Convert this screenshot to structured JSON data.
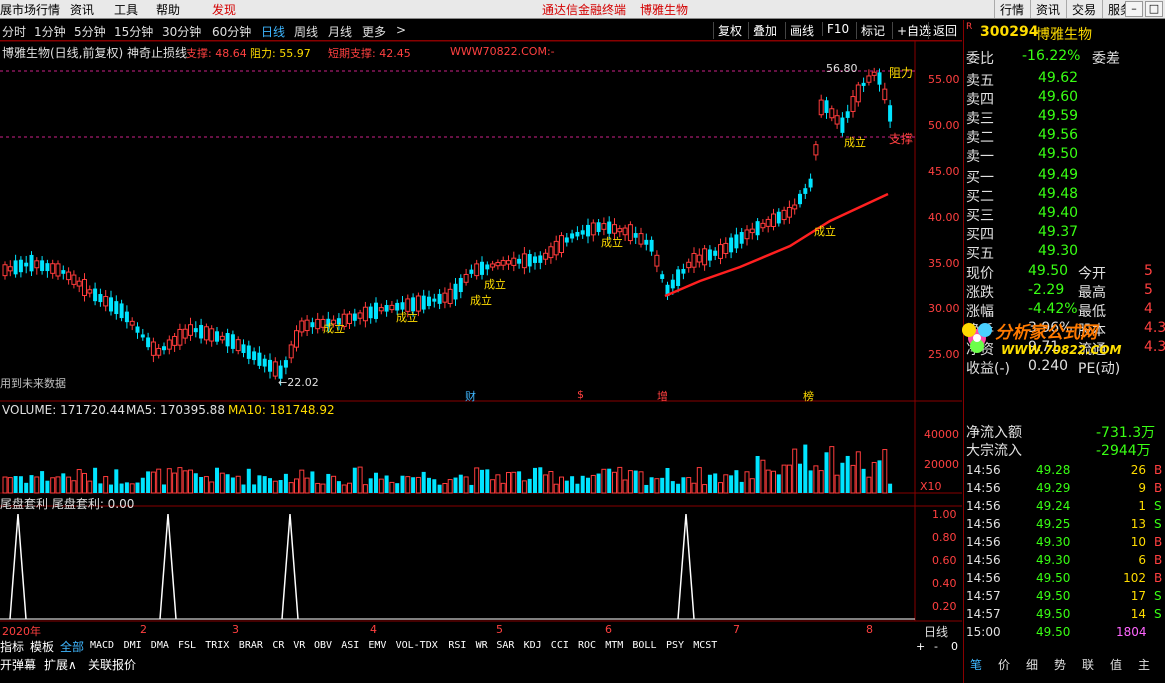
{
  "menubar": {
    "left_items": [
      "展市场行情",
      "资讯",
      "工具",
      "帮助"
    ],
    "discover": "发现",
    "center_links": [
      "通达信金融终端",
      "博雅生物"
    ],
    "right_buttons": [
      "行情",
      "资讯",
      "交易",
      "服务"
    ]
  },
  "periods": [
    "分时",
    "1分钟",
    "5分钟",
    "15分钟",
    "30分钟",
    "60分钟",
    "日线",
    "周线",
    "月线",
    "更多"
  ],
  "active_period": "日线",
  "more_arrow": ">",
  "chart_toolbar": [
    "复权",
    "叠加",
    "画线",
    "F10",
    "标记",
    "+自选",
    "返回"
  ],
  "chart_header": {
    "title": "博雅生物(日线,前复权) 神奇止损线",
    "support": "支撑: 48.64",
    "resistance": "阻力: 55.97",
    "short_support": "短期支撑: 42.45",
    "watermark_url": "WWW70822.COM:-"
  },
  "annotations": {
    "high": "56.80",
    "low": "←22.02",
    "resist_tag": "阻力",
    "support_tag": "支撑",
    "chengli": "成立",
    "future": "用到未来数据",
    "events": [
      "财",
      "$",
      "增",
      "榜"
    ]
  },
  "price_axis": [
    "55.00",
    "50.00",
    "45.00",
    "40.00",
    "35.00",
    "30.00",
    "25.00"
  ],
  "volume_header": {
    "label": "VOLUME: 171720.44",
    "ma5": "MA5: 170395.88",
    "ma10": "MA10: 181748.92"
  },
  "volume_axis": [
    "40000",
    "20000",
    "X10"
  ],
  "indicator_header": "尾盘套利  尾盘套利: 0.00",
  "indicator_axis": [
    "1.00",
    "0.80",
    "0.60",
    "0.40",
    "0.20"
  ],
  "date_axis": [
    "2020年",
    "2",
    "3",
    "4",
    "5",
    "6",
    "7",
    "8"
  ],
  "date_corner": "日线",
  "bottom_nav": [
    "指标",
    "模板",
    "全部"
  ],
  "indicator_tabs": [
    "MACD",
    "DMI",
    "DMA",
    "FSL",
    "TRIX",
    "BRAR",
    "CR",
    "VR",
    "OBV",
    "ASI",
    "EMV",
    "VOL-TDX",
    "RSI",
    "WR",
    "SAR",
    "KDJ",
    "CCI",
    "ROC",
    "MTM",
    "BOLL",
    "PSY",
    "MCST"
  ],
  "bottom_row": [
    "开弹幕",
    "扩展∧",
    "关联报价"
  ],
  "corner_controls": [
    "+",
    "-",
    "0"
  ],
  "quote": {
    "code": "300294",
    "name": "博雅生物",
    "weibi_label": "委比",
    "weibi": "-16.22%",
    "weicha_label": "委差",
    "sells": [
      {
        "label": "卖五",
        "price": "49.62"
      },
      {
        "label": "卖四",
        "price": "49.60"
      },
      {
        "label": "卖三",
        "price": "49.59"
      },
      {
        "label": "卖二",
        "price": "49.56"
      },
      {
        "label": "卖一",
        "price": "49.50"
      }
    ],
    "buys": [
      {
        "label": "买一",
        "price": "49.49"
      },
      {
        "label": "买二",
        "price": "49.48"
      },
      {
        "label": "买三",
        "price": "49.40"
      },
      {
        "label": "买四",
        "price": "49.37"
      },
      {
        "label": "买五",
        "price": "49.30"
      }
    ],
    "stats": [
      {
        "k": "现价",
        "v": "49.50",
        "k2": "今开",
        "v2": "5"
      },
      {
        "k": "涨跌",
        "v": "-2.29",
        "k2": "最高",
        "v2": "5"
      },
      {
        "k": "涨幅",
        "v": "-4.42%",
        "k2": "最低",
        "v2": "4"
      },
      {
        "k": "换手",
        "v": "3.96%",
        "k2": "股本",
        "v2": "4.3"
      },
      {
        "k": "净资",
        "v": "9.71",
        "k2": "流通",
        "v2": "4.3"
      },
      {
        "k": "收益(-)",
        "v": "0.240",
        "k2": "PE(动)",
        "v2": ""
      }
    ],
    "netflow_label": "净流入额",
    "netflow": "-731.3万",
    "block_label": "大宗流入",
    "block": "-2944万",
    "ticks": [
      {
        "t": "14:56",
        "p": "49.28",
        "q": "26",
        "s": "B"
      },
      {
        "t": "14:56",
        "p": "49.29",
        "q": "9",
        "s": "B"
      },
      {
        "t": "14:56",
        "p": "49.24",
        "q": "1",
        "s": "S"
      },
      {
        "t": "14:56",
        "p": "49.25",
        "q": "13",
        "s": "S"
      },
      {
        "t": "14:56",
        "p": "49.30",
        "q": "10",
        "s": "B"
      },
      {
        "t": "14:56",
        "p": "49.30",
        "q": "6",
        "s": "B"
      },
      {
        "t": "14:56",
        "p": "49.50",
        "q": "102",
        "s": "B"
      },
      {
        "t": "14:57",
        "p": "49.50",
        "q": "17",
        "s": "S"
      },
      {
        "t": "14:57",
        "p": "49.50",
        "q": "14",
        "s": "S"
      },
      {
        "t": "15:00",
        "p": "49.50",
        "q": "1804",
        "s": ""
      }
    ],
    "bottom_tabs": [
      "笔",
      "价",
      "细",
      "势",
      "联",
      "值",
      "主"
    ]
  },
  "logo": {
    "text": "分析家公式网",
    "url": "WWW.70822.COM"
  },
  "colors": {
    "up": "#ff3c3c",
    "down": "#00e4ff",
    "yellow": "#ffdc00",
    "magenta": "#ff00ff",
    "green": "#39ff14",
    "grid_red": "#8b0000"
  }
}
